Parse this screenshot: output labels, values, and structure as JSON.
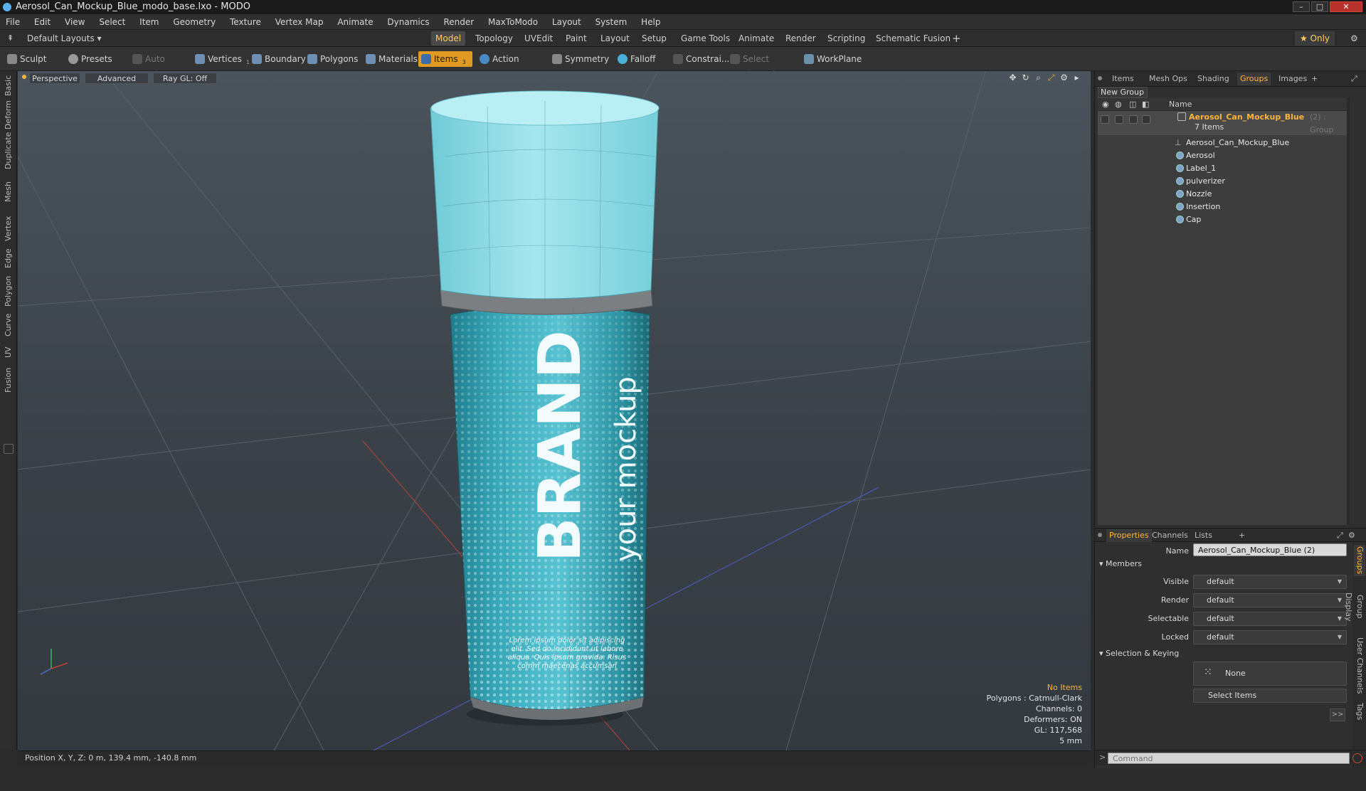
{
  "window": {
    "title": "Aerosol_Can_Mockup_Blue_modo_base.lxo - MODO"
  },
  "menu": [
    "File",
    "Edit",
    "View",
    "Select",
    "Item",
    "Geometry",
    "Texture",
    "Vertex Map",
    "Animate",
    "Dynamics",
    "Render",
    "MaxToModo",
    "Layout",
    "System",
    "Help"
  ],
  "layouts": {
    "default": "Default Layouts ▾",
    "tabs": [
      "Model",
      "Topology",
      "UVEdit",
      "Paint",
      "Layout",
      "Setup",
      "Game Tools",
      "Animate",
      "Render",
      "Scripting",
      "Schematic Fusion"
    ],
    "active": "Model",
    "plus": "+",
    "only": "★ Only"
  },
  "toolbar": {
    "sculpt": "Sculpt",
    "presets": "Presets",
    "auto_select": "Auto Select",
    "vertices": "Vertices",
    "vertices_count": "1",
    "boundary": "Boundary",
    "polygons": "Polygons",
    "materials": "Materials",
    "items": "Items",
    "items_count": "3",
    "action_center": "Action Center",
    "symmetry": "Symmetry",
    "falloff": "Falloff",
    "constraints": "Constrai...",
    "select_through": "Select Through",
    "workplane": "WorkPlane"
  },
  "left_tabs": [
    "Basic",
    "Deform",
    "Duplicate",
    "Mesh Edit",
    "Vertex",
    "Edge",
    "Polygon",
    "Curve",
    "UV",
    "Fusion"
  ],
  "viewport": {
    "view": "Perspective",
    "shading": "Advanced",
    "raygl": "Ray GL: Off",
    "can": {
      "brand": "BRAND",
      "tagline": "your mockup",
      "body_text": "Lorem ipsum dolor sit adipiscing elit. Sed do incididunt ut labore aliqua. Quis ipsum gravida. Risus comm maecenas accumsan"
    },
    "hud": {
      "no_items": "No Items",
      "polygons": "Polygons : Catmull-Clark",
      "channels": "Channels: 0",
      "deformers": "Deformers: ON",
      "gl": "GL: 117,568",
      "grid": "5 mm"
    }
  },
  "status": {
    "position": "Position X, Y, Z:  0 m, 139.4 mm, -140.8 mm"
  },
  "panel_tabs": [
    "Items",
    "Mesh Ops",
    "Shading",
    "Groups",
    "Images"
  ],
  "panel_tabs_active": "Groups",
  "groups": {
    "new_group": "New Group",
    "name_col": "Name",
    "group_name": "Aerosol_Can_Mockup_Blue",
    "group_suffix": "(2) : Group",
    "items_count": "7 Items",
    "items": [
      "Aerosol_Can_Mockup_Blue",
      "Aerosol",
      "Label_1",
      "pulverizer",
      "Nozzle",
      "Insertion",
      "Cap"
    ]
  },
  "props_tabs": [
    "Properties",
    "Channels",
    "Lists"
  ],
  "props": {
    "name_label": "Name",
    "name_value": "Aerosol_Can_Mockup_Blue (2)",
    "members": "Members",
    "visible": "Visible",
    "render": "Render",
    "selectable": "Selectable",
    "locked": "Locked",
    "default_val": "default",
    "sel_keying": "Selection & Keying",
    "none": "None",
    "select_items": "Select Items",
    "expand": ">>"
  },
  "side_tabs": [
    "Groups",
    "Group Display",
    "User Channels",
    "Tags"
  ],
  "command_placeholder": "Command",
  "colors": {
    "accent": "#ffb43c",
    "can_blue": "#3fb3c4",
    "cap_blue": "#9fe0ea"
  }
}
